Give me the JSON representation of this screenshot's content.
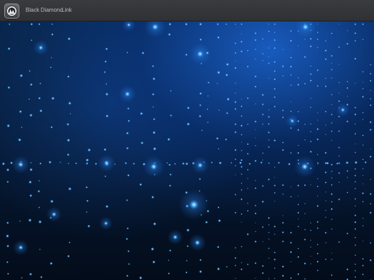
{
  "topbar": {
    "app_name": "Black Diamond",
    "link_label": "Link",
    "app_icon": "black-diamond-app-icon"
  },
  "wallpaper": {
    "theme": "blue-particle-grid",
    "colors": {
      "deep": "#030c1a",
      "mid": "#0b3a7a",
      "glow": "#3fa9ff",
      "particle_core": "#bfe6ff"
    }
  }
}
